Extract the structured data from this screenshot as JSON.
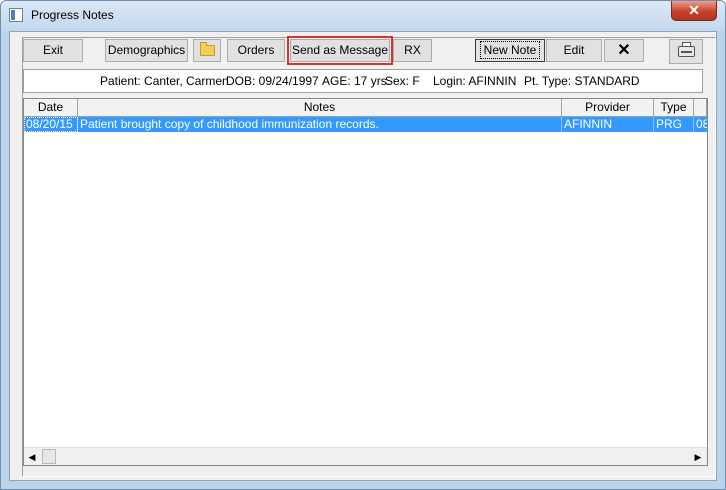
{
  "window": {
    "title": "Progress Notes",
    "close_label": "✕"
  },
  "toolbar": {
    "exit": "Exit",
    "demographics": "Demographics",
    "orders": "Orders",
    "send_as_message": "Send as Message",
    "rx": "RX",
    "new_note": "New Note",
    "edit": "Edit",
    "delete_label": "✕"
  },
  "icons": {
    "folder": "folder-icon",
    "printer": "printer-icon",
    "delete": "x-icon"
  },
  "patient": {
    "name": "Patient: Canter, Carmen",
    "dob": "DOB: 09/24/1997",
    "age": "AGE: 17 yrs.",
    "sex": "Sex: F",
    "login": "Login: AFINNIN",
    "type": "Pt. Type: STANDARD"
  },
  "grid": {
    "columns": [
      "Date",
      "Notes",
      "Provider",
      "Type",
      ""
    ],
    "rows": [
      {
        "date": "08/20/15",
        "note": "Patient brought copy of childhood immunization records.",
        "provider": "AFINNIN",
        "type": "PRG",
        "extra": "08"
      }
    ]
  },
  "colors": {
    "selection": "#3399ff",
    "highlight_outline": "#d9342b"
  }
}
